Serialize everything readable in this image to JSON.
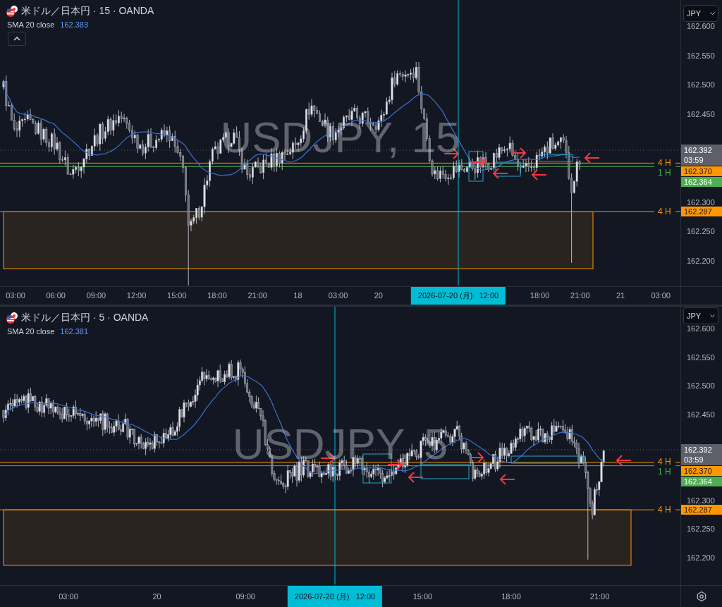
{
  "panes": [
    {
      "title": "米ドル／日本円 · 15 · OANDA",
      "indicator": {
        "label": "SMA 20 close",
        "value": "162.383"
      },
      "collapse_button": true,
      "watermark": "USDJPY, 15",
      "currency": "JPY",
      "price_ticks": [
        "162.600",
        "162.550",
        "162.500",
        "162.450",
        "162.300",
        "162.250",
        "162.200"
      ],
      "price_tags": [
        {
          "kind": "last",
          "price": "162.392",
          "countdown": "03:59",
          "color": "#5d606b"
        },
        {
          "kind": "level",
          "price": "162.370",
          "color": "#ff9800",
          "line_label": "4 H"
        },
        {
          "kind": "level",
          "price": "162.364",
          "color": "#4caf50",
          "line_label": "1 H"
        },
        {
          "kind": "level",
          "price": "162.287",
          "color": "#ff9800",
          "line_label": "4 H"
        }
      ],
      "time_ticks": [
        "03:00",
        "06:00",
        "09:00",
        "12:00",
        "15:00",
        "18:00",
        "21:00",
        "18",
        "03:00",
        "20",
        "18:00",
        "21:00",
        "21",
        "03:00"
      ],
      "crosshair_label": "2026-07-20 (月)   12:00"
    },
    {
      "title": "米ドル／日本円 · 5 · OANDA",
      "indicator": {
        "label": "SMA 20 close",
        "value": "162.381"
      },
      "axis_settings": true,
      "watermark": "USDJPY, 5",
      "currency": "JPY",
      "price_ticks": [
        "162.600",
        "162.550",
        "162.500",
        "162.450",
        "162.300",
        "162.250",
        "162.200"
      ],
      "price_tags": [
        {
          "kind": "last",
          "price": "162.392",
          "countdown": "03:59",
          "color": "#5d606b"
        },
        {
          "kind": "level",
          "price": "162.370",
          "color": "#ff9800",
          "line_label": "4 H"
        },
        {
          "kind": "level",
          "price": "162.364",
          "color": "#4caf50",
          "line_label": "1 H"
        },
        {
          "kind": "level",
          "price": "162.287",
          "color": "#ff9800",
          "line_label": "4 H"
        }
      ],
      "time_ticks": [
        "03:00",
        "20",
        "09:00",
        "15:00",
        "18:00",
        "21:00"
      ],
      "crosshair_label": "2026-07-20 (月)   12:00"
    }
  ]
}
